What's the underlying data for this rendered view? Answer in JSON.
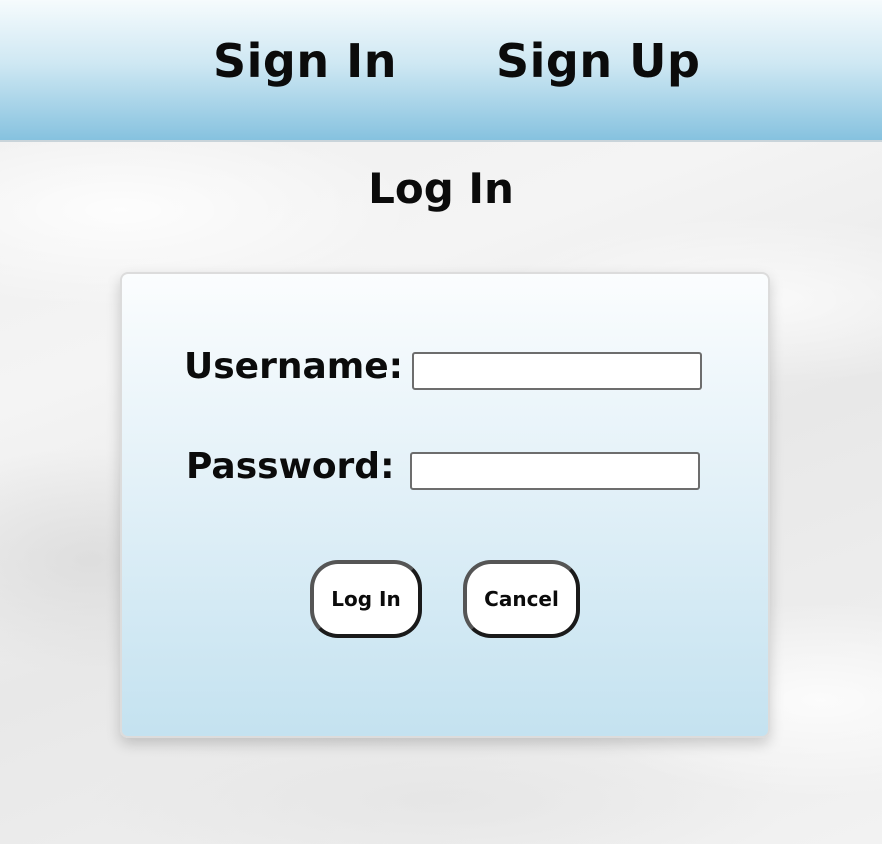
{
  "nav": {
    "sign_in": "Sign In",
    "sign_up": "Sign Up"
  },
  "page": {
    "title": "Log In"
  },
  "form": {
    "username_label": "Username:",
    "username_value": "",
    "password_label": "Password:",
    "password_value": "",
    "login_button": "Log In",
    "cancel_button": "Cancel"
  },
  "colors": {
    "nav_gradient_top": "#f6fbfd",
    "nav_gradient_bottom": "#86c2df",
    "card_gradient_top": "#fbfdfe",
    "card_gradient_bottom": "#c4e2f0",
    "text": "#0b0b0b"
  }
}
